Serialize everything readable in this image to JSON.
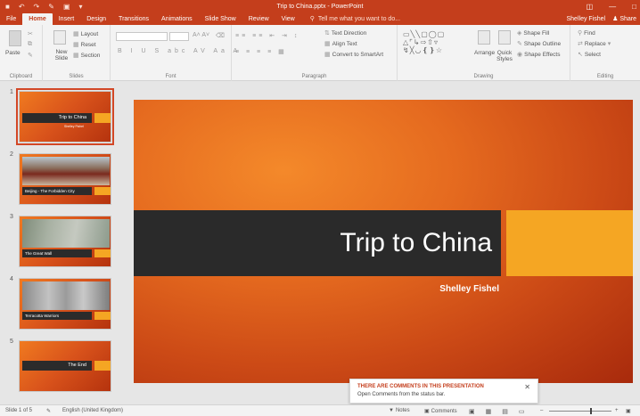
{
  "window": {
    "title": "Trip to China.pptx - PowerPoint",
    "user": "Shelley Fishel",
    "share_label": "Share"
  },
  "tabs": [
    {
      "label": "File"
    },
    {
      "label": "Home"
    },
    {
      "label": "Insert"
    },
    {
      "label": "Design"
    },
    {
      "label": "Transitions"
    },
    {
      "label": "Animations"
    },
    {
      "label": "Slide Show"
    },
    {
      "label": "Review"
    },
    {
      "label": "View"
    }
  ],
  "tellme": {
    "placeholder": "Tell me what you want to do..."
  },
  "ribbon": {
    "clipboard": {
      "label": "Clipboard",
      "paste": "Paste"
    },
    "slides": {
      "label": "Slides",
      "new_slide": "New Slide",
      "layout": "Layout",
      "reset": "Reset",
      "section": "Section"
    },
    "font": {
      "label": "Font"
    },
    "paragraph": {
      "label": "Paragraph",
      "text_direction": "Text Direction",
      "align_text": "Align Text",
      "smartart": "Convert to SmartArt"
    },
    "drawing": {
      "label": "Drawing",
      "arrange": "Arrange",
      "quick_styles": "Quick Styles",
      "shape_fill": "Shape Fill",
      "shape_outline": "Shape Outline",
      "shape_effects": "Shape Effects"
    },
    "editing": {
      "label": "Editing",
      "find": "Find",
      "replace": "Replace",
      "select": "Select"
    }
  },
  "slides": [
    {
      "number": "1",
      "title": "Trip to China",
      "subtitle": "Shelley Fishel"
    },
    {
      "number": "2",
      "caption": "Beijing - The Forbidden City"
    },
    {
      "number": "3",
      "caption": "The Great Wall"
    },
    {
      "number": "4",
      "caption": "Terracotta Warriors"
    },
    {
      "number": "5",
      "title": "The End"
    }
  ],
  "main_slide": {
    "title": "Trip to China",
    "subtitle": "Shelley Fishel"
  },
  "toast": {
    "title": "THERE ARE COMMENTS IN THIS PRESENTATION",
    "body": "Open Comments from the status bar."
  },
  "statusbar": {
    "slide_info": "Slide 1 of 5",
    "language": "English (United Kingdom)",
    "notes": "Notes",
    "comments": "Comments"
  }
}
